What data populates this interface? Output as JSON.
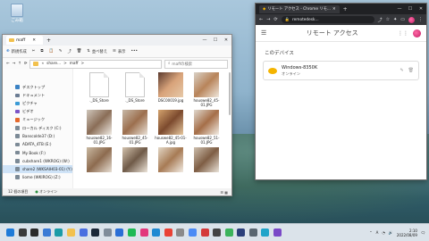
{
  "desktop": {
    "recycle_label": "ごみ箱"
  },
  "explorer": {
    "tab_title": "maff",
    "toolbar": {
      "new": "新規作成",
      "sort": "並べ替え",
      "view": "表示",
      "more": "•••"
    },
    "breadcrumb": [
      "«",
      "share...",
      ">",
      "maff",
      ">"
    ],
    "search_placeholder": "maffの検索",
    "nav": [
      {
        "label": "デスクトップ",
        "color": "#3b82c4"
      },
      {
        "label": "ドキュメント",
        "color": "#6b7c93"
      },
      {
        "label": "ピクチャ",
        "color": "#3c9bd6"
      },
      {
        "label": "ビデオ",
        "color": "#7b55c7"
      },
      {
        "label": "ミュージック",
        "color": "#e5692c"
      },
      {
        "label": "ローカル ディスク (C:)",
        "color": "#7c8a96"
      },
      {
        "label": "Banscolde37 (D:)",
        "color": "#7c8a96"
      },
      {
        "label": "ADATA_4TB (E:)",
        "color": "#7c8a96"
      },
      {
        "label": "My Book (F:)",
        "color": "#7c8a96"
      },
      {
        "label": "cubshare1 (WKROG) (W:)",
        "color": "#7c8a96"
      },
      {
        "label": "share2 (WKSAIH03-01) (Y:)",
        "color": "#7c8a96",
        "selected": true
      },
      {
        "label": "liome (WKIROG) (Z:)",
        "color": "#7c8a96"
      }
    ],
    "files": [
      {
        "name": "._DS_Store",
        "kind": "doc"
      },
      {
        "name": "._DS_Store",
        "kind": "doc"
      },
      {
        "name": "DSC00019.jpg",
        "kind": "photo",
        "colors": [
          "#5b3a2e",
          "#d8a37a",
          "#e6c9a9"
        ]
      },
      {
        "name": "houswe82_45-01.JPG",
        "kind": "photo",
        "colors": [
          "#d9d2c8",
          "#b8845a",
          "#efe7dc"
        ]
      },
      {
        "name": "houswe82_16-01.JPG",
        "kind": "photo",
        "colors": [
          "#cfc6bb",
          "#8a6d57",
          "#f0ebe4"
        ]
      },
      {
        "name": "houswe82_45-01.JPG",
        "kind": "photo",
        "colors": [
          "#c7b9a8",
          "#9c6f4e",
          "#e9e1d6"
        ]
      },
      {
        "name": "houswe82_45-01-A.jpg",
        "kind": "photo",
        "colors": [
          "#d4a36e",
          "#7c4a2e",
          "#e6c79e"
        ]
      },
      {
        "name": "houswe82_51-01.JPG",
        "kind": "photo",
        "colors": [
          "#e0d9cf",
          "#a56e48",
          "#f3eee6"
        ]
      },
      {
        "name": "",
        "kind": "photo",
        "colors": [
          "#c9b9a2",
          "#8d6b4f",
          "#e7dfd4"
        ]
      },
      {
        "name": "",
        "kind": "photo",
        "colors": [
          "#d2c2ad",
          "#6f5a48",
          "#ece4d9"
        ]
      },
      {
        "name": "",
        "kind": "photo",
        "colors": [
          "#e3d7c6",
          "#a77b55",
          "#f2ece4"
        ]
      },
      {
        "name": "",
        "kind": "photo",
        "colors": [
          "#cdbfae",
          "#7e5d44",
          "#eae3d9"
        ]
      }
    ],
    "status": {
      "count": "12 個の項目",
      "state": "オンライン"
    }
  },
  "chrome": {
    "tab_title": "リモート アクセス - Chrome リモ...",
    "url": "remotedesk...",
    "app_title": "リモート アクセス",
    "section": "このデバイス",
    "device": {
      "name": "Windows-8350K",
      "status": "オンライン"
    }
  },
  "taskbar": {
    "icons": [
      {
        "name": "start-icon",
        "color": "#1e7bd8"
      },
      {
        "name": "search-icon",
        "color": "#3a3a3a"
      },
      {
        "name": "task-view-icon",
        "color": "#2b2b2b"
      },
      {
        "name": "widgets-icon",
        "color": "#3a7bd5"
      },
      {
        "name": "edge-icon",
        "color": "#1a9ba6"
      },
      {
        "name": "explorer-icon",
        "color": "#f2c14e"
      },
      {
        "name": "store-icon",
        "color": "#4a6fe0"
      },
      {
        "name": "steam-icon",
        "color": "#1b2838"
      },
      {
        "name": "shield-icon",
        "color": "#7f8c99"
      },
      {
        "name": "app-icon-blue",
        "color": "#2a6fd6"
      },
      {
        "name": "spotify-icon",
        "color": "#1db954"
      },
      {
        "name": "app-icon-pink",
        "color": "#e2387c"
      },
      {
        "name": "vscode-icon",
        "color": "#1f8ad2"
      },
      {
        "name": "chrome-icon",
        "color": "#e94235"
      },
      {
        "name": "app-icon-gray",
        "color": "#8a8a8a"
      },
      {
        "name": "photos-icon",
        "color": "#4b8bf5"
      },
      {
        "name": "app-icon-red",
        "color": "#d43a3a"
      },
      {
        "name": "app-icon-dark",
        "color": "#444"
      },
      {
        "name": "app-icon-green",
        "color": "#3bb35b"
      },
      {
        "name": "app-icon-navy",
        "color": "#2b3f7a"
      },
      {
        "name": "settings-icon",
        "color": "#5a6670"
      },
      {
        "name": "app-icon-cyan",
        "color": "#20a4c9"
      },
      {
        "name": "app-icon-purple",
        "color": "#7a49c7"
      }
    ],
    "time": "2:10",
    "date": "2022/08/09",
    "lang": "A"
  }
}
